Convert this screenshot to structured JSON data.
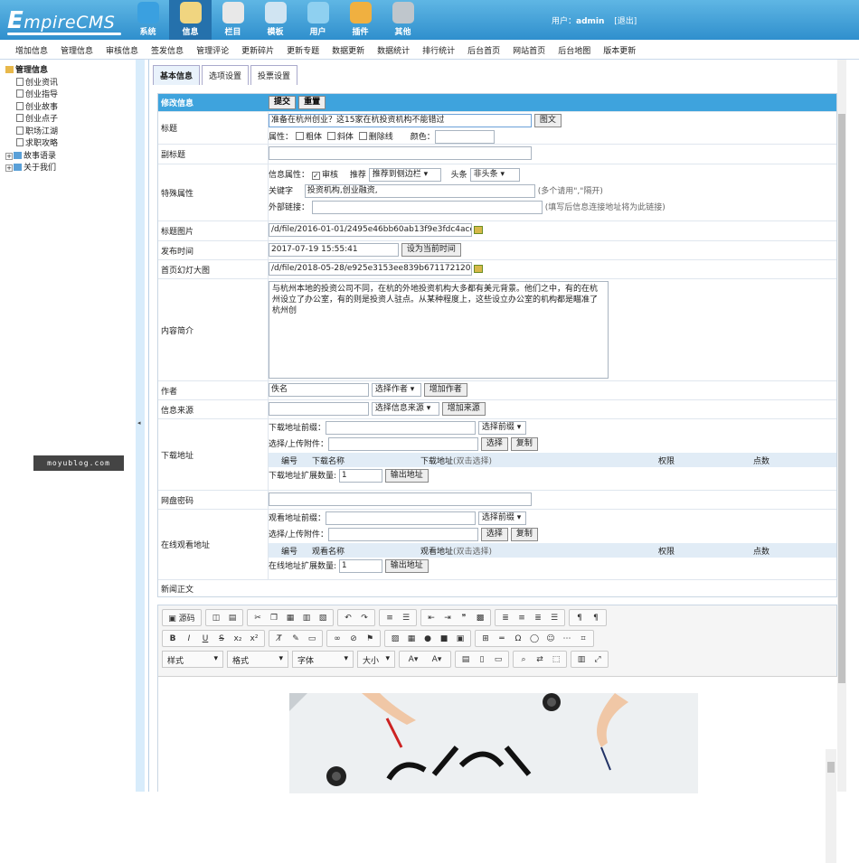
{
  "app": {
    "logo": "EmpireCMS"
  },
  "nav": {
    "items": [
      {
        "label": "系统",
        "icon": "globe-icon",
        "color": "#3aa0e0"
      },
      {
        "label": "信息",
        "icon": "edit-icon",
        "color": "#f0d580",
        "active": true
      },
      {
        "label": "栏目",
        "icon": "folder-icon",
        "color": "#e8e8e8"
      },
      {
        "label": "模板",
        "icon": "window-icon",
        "color": "#d0e4f2"
      },
      {
        "label": "用户",
        "icon": "user-icon",
        "color": "#8fd0f0"
      },
      {
        "label": "插件",
        "icon": "tools-icon",
        "color": "#f0b040"
      },
      {
        "label": "其他",
        "icon": "gear-icon",
        "color": "#bfc6cc"
      }
    ]
  },
  "user": {
    "prefix": "用户：",
    "name": "admin",
    "logout": "[退出]"
  },
  "menu": [
    "增加信息",
    "管理信息",
    "审核信息",
    "签发信息",
    "管理评论",
    "更新碎片",
    "更新专题",
    "数据更新",
    "数据统计",
    "排行统计",
    "后台首页",
    "网站首页",
    "后台地图",
    "版本更新"
  ],
  "tree": {
    "root": "管理信息",
    "items": [
      "创业资讯",
      "创业指导",
      "创业故事",
      "创业点子",
      "职场江湖",
      "求职攻略"
    ],
    "folders": [
      "故事语录",
      "关于我们"
    ]
  },
  "watermark": "moyublog.com",
  "tabs": [
    "基本信息",
    "选项设置",
    "投票设置"
  ],
  "form": {
    "header": "修改信息",
    "submit": "提交",
    "reset": "重置",
    "title": {
      "label": "标题",
      "value": "准备在杭州创业？这15家在杭投资机构不能错过",
      "btn": "图文",
      "attr": "属性：",
      "bold": "粗体",
      "italic": "斜体",
      "strike": "删除线",
      "color": "颜色："
    },
    "subtitle": {
      "label": "副标题",
      "value": ""
    },
    "special": {
      "label": "特殊属性",
      "infoattr": "信息属性：",
      "audit": "审核",
      "recommend": "推荐",
      "recommend_sel": "推荐到侧边栏",
      "headline": "头条",
      "headline_sel": "非头条",
      "keyword_label": "关键字",
      "keyword": "投资机构,创业融资,",
      "keyword_hint": "(多个请用\",\"隔开)",
      "extlink": "外部链接：",
      "extlink_hint": "(填写后信息连接地址将为此链接)"
    },
    "titlepic": {
      "label": "标题图片",
      "value": "/d/file/2016-01-01/2495e46bb60ab13f9e3fdc4accc59"
    },
    "pubtime": {
      "label": "发布时间",
      "value": "2017-07-19 15:55:41",
      "btn": "设为当前时间"
    },
    "slide": {
      "label": "首页幻灯大图",
      "value": "/d/file/2018-05-28/e925e3153ee839b671172120445"
    },
    "intro": {
      "label": "内容简介",
      "value": "与杭州本地的投资公司不同，在杭的外地投资机构大多都有美元背景。他们之中，有的在杭州设立了办公室，有的则是投资人驻点。从某种程度上，这些设立办公室的机构都是瞄准了杭州创"
    },
    "author": {
      "label": "作者",
      "value": "佚名",
      "sel": "选择作者",
      "btn": "增加作者"
    },
    "source": {
      "label": "信息来源",
      "value": "",
      "sel": "选择信息来源",
      "btn": "增加来源"
    },
    "download": {
      "label": "下载地址",
      "prefix": "下载地址前缀：",
      "prefix_sel": "选择前缀",
      "upload": "选择/上传附件：",
      "choose": "选择",
      "copy": "复制",
      "cols": [
        "编号",
        "下载名称",
        "下载地址",
        "(双击选择)",
        "权限",
        "点数"
      ],
      "ext": "下载地址扩展数量:",
      "ext_val": "1",
      "out": "输出地址"
    },
    "pan": {
      "label": "网盘密码",
      "value": ""
    },
    "online": {
      "label": "在线观看地址",
      "prefix": "观看地址前缀：",
      "prefix_sel": "选择前缀",
      "upload": "选择/上传附件：",
      "choose": "选择",
      "copy": "复制",
      "cols": [
        "编号",
        "观看名称",
        "观看地址",
        "(双击选择)",
        "权限",
        "点数"
      ],
      "ext": "在线地址扩展数量:",
      "ext_val": "1",
      "out": "输出地址"
    },
    "body": {
      "label": "新闻正文"
    }
  },
  "editor": {
    "source": "源码",
    "dropdowns": [
      "样式",
      "格式",
      "字体",
      "大小"
    ]
  }
}
